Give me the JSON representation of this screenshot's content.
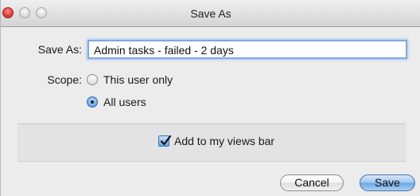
{
  "window": {
    "title": "Save As"
  },
  "form": {
    "save_as_label": "Save As:",
    "save_as_value": "Admin tasks - failed - 2 days",
    "scope_label": "Scope:",
    "scope_options": [
      {
        "label": "This user only",
        "selected": false
      },
      {
        "label": "All users",
        "selected": true
      }
    ]
  },
  "views_bar": {
    "label": "Add to my views bar",
    "checked": true
  },
  "buttons": {
    "cancel": "Cancel",
    "save": "Save"
  },
  "colors": {
    "accent": "#6aa4e4",
    "close_button": "#e2403a"
  }
}
